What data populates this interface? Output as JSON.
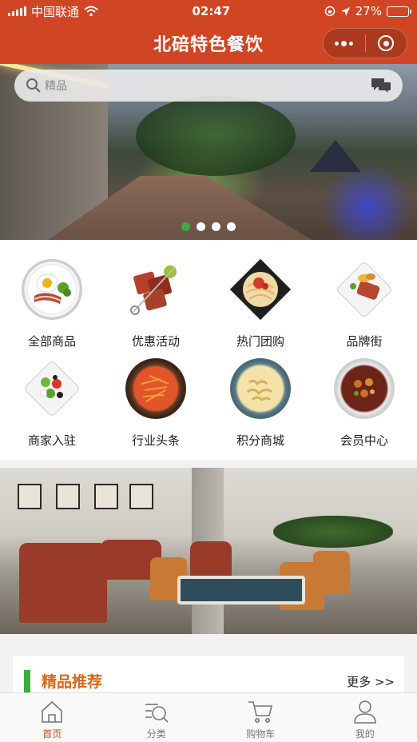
{
  "status_bar": {
    "carrier": "中国联通",
    "time": "02:47",
    "battery": "27%",
    "battery_level": 0.27
  },
  "header": {
    "title": "北碚特色餐饮",
    "menu_icon": "more-dots-icon",
    "close_icon": "target-close-icon",
    "background_color": "#d04624"
  },
  "banner": {
    "search_placeholder": "精品",
    "slides_total": 4,
    "active_slide": 1,
    "indicator_active_color": "#3faa3f"
  },
  "categories": [
    {
      "label": "全部商品",
      "icon": "breakfast-plate-icon"
    },
    {
      "label": "优惠活动",
      "icon": "skewer-icon"
    },
    {
      "label": "热门团购",
      "icon": "noodle-plate-icon"
    },
    {
      "label": "品牌街",
      "icon": "steak-plate-icon"
    },
    {
      "label": "商家入驻",
      "icon": "salad-plate-icon"
    },
    {
      "label": "行业头条",
      "icon": "carrot-plate-icon"
    },
    {
      "label": "积分商城",
      "icon": "pasta-bowl-icon"
    },
    {
      "label": "会员中心",
      "icon": "stew-bowl-icon"
    }
  ],
  "featured": {
    "title": "精品推荐",
    "more": "更多 >>",
    "accent_color": "#d7691f",
    "bar_color": "#3faa3f"
  },
  "tabbar": {
    "tabs": [
      {
        "label": "首页",
        "icon": "home-icon",
        "active": true
      },
      {
        "label": "分类",
        "icon": "category-search-icon",
        "active": false
      },
      {
        "label": "购物车",
        "icon": "cart-icon",
        "active": false
      },
      {
        "label": "我的",
        "icon": "user-icon",
        "active": false
      }
    ]
  }
}
